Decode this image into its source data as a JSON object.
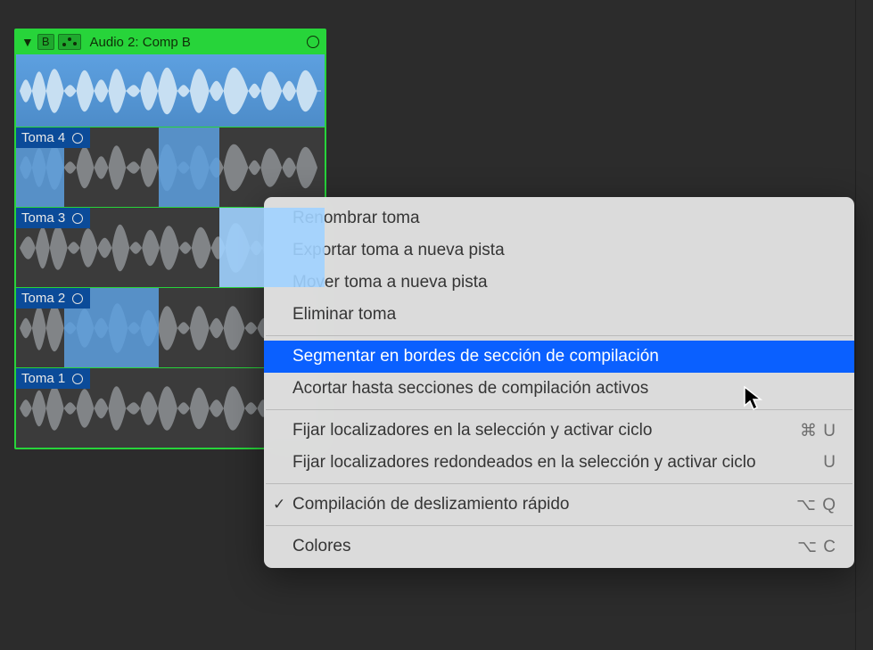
{
  "folder": {
    "comp_button": "B",
    "title": "Audio 2: Comp B"
  },
  "takes": [
    {
      "label": "Toma 4"
    },
    {
      "label": "Toma 3"
    },
    {
      "label": "Toma 2"
    },
    {
      "label": "Toma 1"
    }
  ],
  "menu": {
    "rename": {
      "label": "Renombrar toma"
    },
    "export": {
      "label": "Exportar toma a nueva pista"
    },
    "move": {
      "label": "Mover toma a nueva pista"
    },
    "delete": {
      "label": "Eliminar toma"
    },
    "slice": {
      "label": "Segmentar en bordes de sección de compilación"
    },
    "trim": {
      "label": "Acortar hasta secciones de compilación activos"
    },
    "locators": {
      "label": "Fijar localizadores en la selección y activar ciclo",
      "shortcut": "⌘ U"
    },
    "locators_round": {
      "label": "Fijar localizadores redondeados en la selección y activar ciclo",
      "shortcut": "U"
    },
    "quick_swipe": {
      "label": "Compilación de deslizamiento rápido",
      "shortcut": "⌥ Q",
      "checked": true
    },
    "colors": {
      "label": "Colores",
      "shortcut": "⌥ C"
    }
  }
}
